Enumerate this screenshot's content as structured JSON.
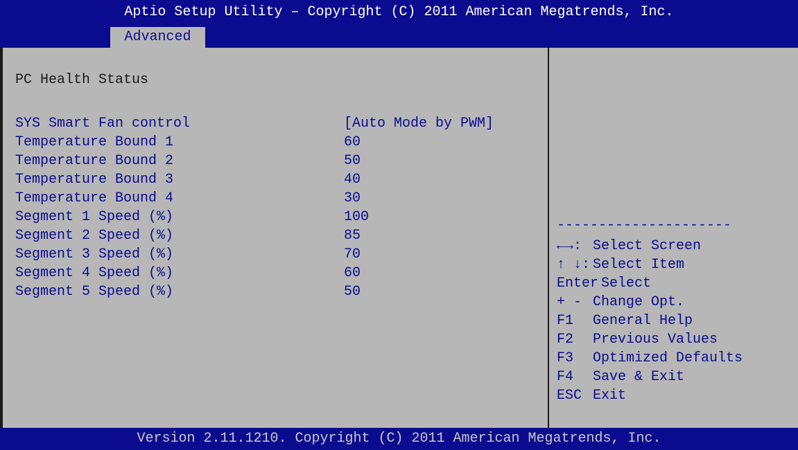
{
  "header": {
    "title": "Aptio Setup Utility – Copyright (C) 2011 American Megatrends, Inc."
  },
  "tabs": [
    {
      "label": "Advanced",
      "active": true
    }
  ],
  "main": {
    "section_title": "PC Health Status",
    "items": [
      {
        "label": "SYS Smart Fan control",
        "value": "[Auto Mode by PWM]"
      },
      {
        "label": "Temperature Bound 1",
        "value": "60"
      },
      {
        "label": "Temperature Bound 2",
        "value": "50"
      },
      {
        "label": "Temperature Bound 3",
        "value": "40"
      },
      {
        "label": "Temperature Bound 4",
        "value": "30"
      },
      {
        "label": "Segment 1 Speed (%)",
        "value": "100"
      },
      {
        "label": "Segment 2 Speed (%)",
        "value": "85"
      },
      {
        "label": "Segment 3 Speed (%)",
        "value": "70"
      },
      {
        "label": "Segment 4 Speed (%)",
        "value": "60"
      },
      {
        "label": "Segment 5 Speed (%)",
        "value": "50"
      }
    ]
  },
  "help": {
    "separator": "---------------------",
    "keys": [
      {
        "key": "←→:",
        "desc": "Select Screen"
      },
      {
        "key": "↑ ↓:",
        "desc": "Select Item"
      },
      {
        "key": "Enter",
        "desc": "Select"
      },
      {
        "key": "+ -",
        "desc": "Change Opt."
      },
      {
        "key": "F1",
        "desc": "General Help"
      },
      {
        "key": "F2",
        "desc": "Previous Values"
      },
      {
        "key": "F3",
        "desc": "Optimized Defaults"
      },
      {
        "key": "F4",
        "desc": "Save & Exit"
      },
      {
        "key": "ESC",
        "desc": "Exit"
      }
    ]
  },
  "footer": {
    "text": "Version 2.11.1210. Copyright (C) 2011 American Megatrends, Inc."
  },
  "colors": {
    "bar_blue": "#0b0b8f",
    "panel_gray": "#b7b7b7",
    "text_blue": "#0b0b8f"
  }
}
